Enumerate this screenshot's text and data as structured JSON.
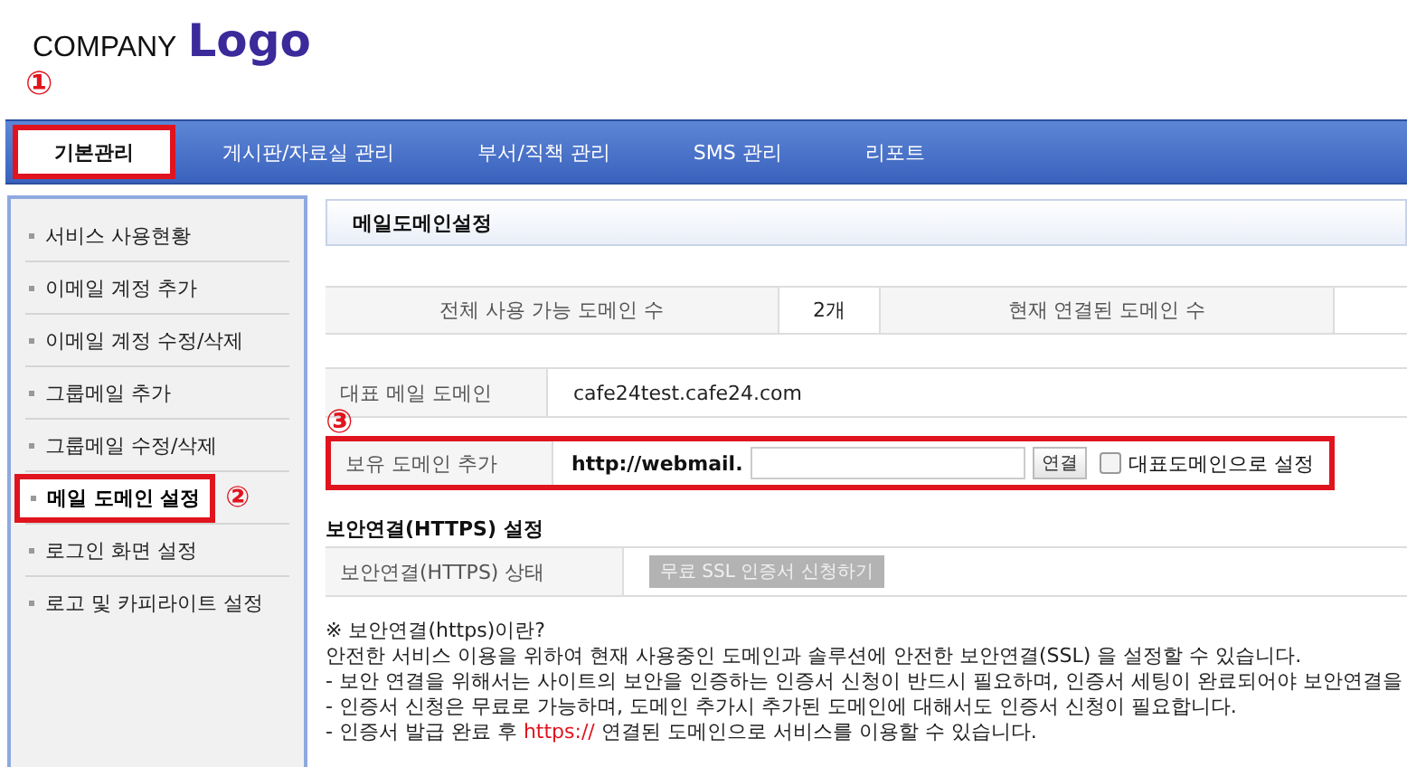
{
  "logo": {
    "company": "COMPANY",
    "logo": "Logo"
  },
  "nav": {
    "marker": "①",
    "tabs": [
      {
        "label": "기본관리",
        "selected": true,
        "highlighted": true
      },
      {
        "label": "게시판/자료실 관리",
        "selected": false,
        "highlighted": false
      },
      {
        "label": "부서/직책 관리",
        "selected": false,
        "highlighted": false
      },
      {
        "label": "SMS 관리",
        "selected": false,
        "highlighted": false
      },
      {
        "label": "리포트",
        "selected": false,
        "highlighted": false
      }
    ]
  },
  "sidebar": {
    "items": [
      {
        "label": "서비스 사용현황",
        "selected": false,
        "highlighted": false
      },
      {
        "label": "이메일 계정 추가",
        "selected": false,
        "highlighted": false
      },
      {
        "label": "이메일 계정 수정/삭제",
        "selected": false,
        "highlighted": false
      },
      {
        "label": "그룹메일 추가",
        "selected": false,
        "highlighted": false
      },
      {
        "label": "그룹메일 수정/삭제",
        "selected": false,
        "highlighted": false
      },
      {
        "label": "메일 도메인 설정",
        "selected": true,
        "highlighted": true,
        "marker": "②"
      },
      {
        "label": "로그인 화면 설정",
        "selected": false,
        "highlighted": false
      },
      {
        "label": "로고 및 카피라이트 설정",
        "selected": false,
        "highlighted": false
      }
    ]
  },
  "page_title": "메일도메인설정",
  "stats": {
    "total_label": "전체 사용 가능 도메인 수",
    "total_value": "2개",
    "connected_label": "현재 연결된 도메인 수"
  },
  "main_domain": {
    "label": "대표 메일 도메인",
    "value": "cafe24test.cafe24.com"
  },
  "add_domain": {
    "marker": "③",
    "highlighted": true,
    "label": "보유 도메인 추가",
    "prefix": "http://webmail.",
    "button": "연결",
    "checkbox_label": "대표도메인으로 설정",
    "checked": false
  },
  "https": {
    "title": "보안연결(HTTPS) 설정",
    "label": "보안연결(HTTPS) 상태",
    "button": "무료 SSL 인증서 신청하기",
    "button_disabled": true
  },
  "notes": {
    "heading": "※ 보안연결(https)이란?",
    "lines": [
      "안전한 서비스 이용을 위하여 현재 사용중인 도메인과 솔루션에 안전한 보안연결(SSL) 을 설정할 수 있습니다.",
      "- 보안 연결을 위해서는 사이트의 보안을 인증하는 인증서 신청이 반드시 필요하며, 인증서 세팅이 완료되어야 보안연결을",
      "- 인증서 신청은 무료로 가능하며, 도메인 추가시 추가된 도메인에 대해서도 인증서 신청이 필요합니다."
    ],
    "last_line": {
      "before": "- 인증서 발급 완료 후 ",
      "link": "https://",
      "after": " 연결된 도메인으로 서비스를 이용할 수 있습니다."
    }
  }
}
